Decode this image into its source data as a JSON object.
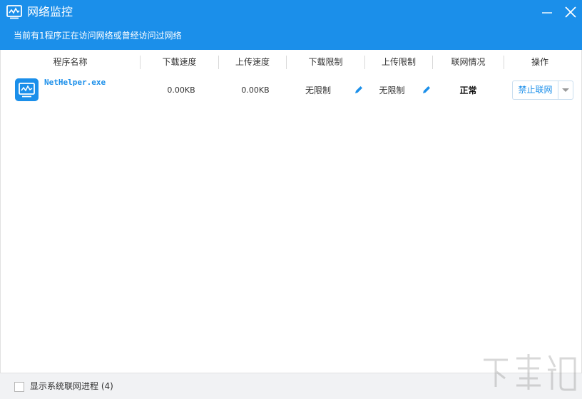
{
  "window": {
    "title": "网络监控",
    "subtitle": "当前有1程序正在访问网络或曾经访问过网络"
  },
  "columns": {
    "name": "程序名称",
    "download_speed": "下载速度",
    "upload_speed": "上传速度",
    "download_limit": "下载限制",
    "upload_limit": "上传限制",
    "status": "联网情况",
    "action": "操作"
  },
  "rows": [
    {
      "name": "NetHelper.exe",
      "download_speed": "0.00KB",
      "upload_speed": "0.00KB",
      "download_limit": "无限制",
      "upload_limit": "无限制",
      "status": "正常",
      "action": "禁止联网"
    }
  ],
  "footer": {
    "show_system_label": "显示系统联网进程 (4)",
    "show_system_checked": false
  },
  "colors": {
    "accent": "#1b8fea",
    "footer_bg": "#f1f2f4"
  },
  "icons": {
    "app": "monitor-chart-icon",
    "minimize": "minimize-icon",
    "close": "close-icon",
    "edit": "pencil-icon",
    "dropdown": "chevron-down-icon"
  }
}
